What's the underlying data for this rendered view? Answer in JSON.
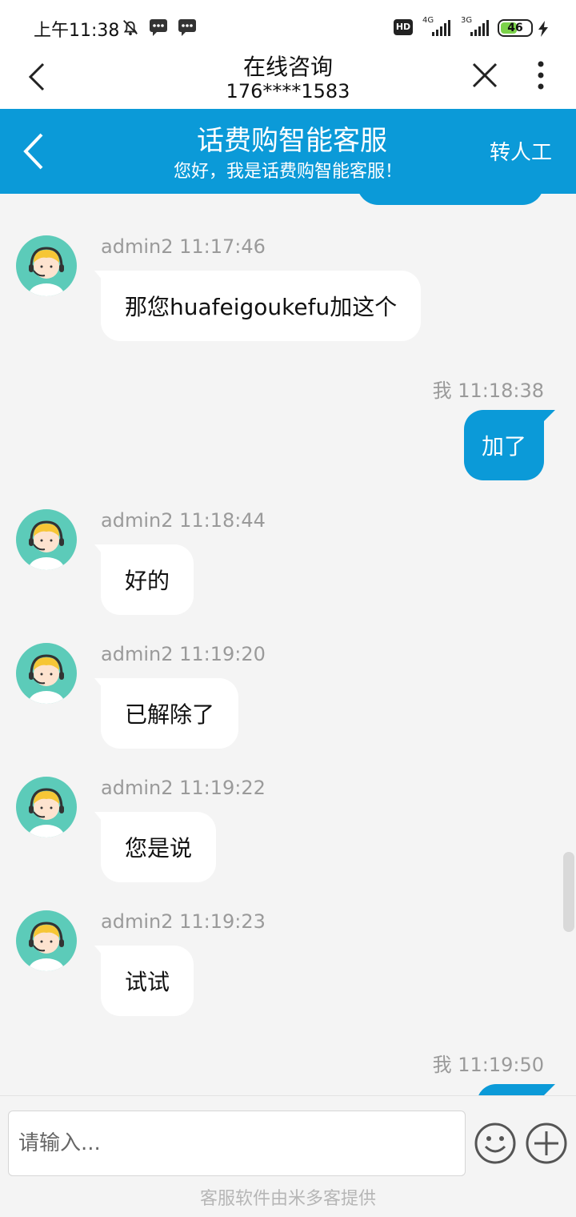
{
  "status_bar": {
    "time": "上午11:38",
    "hd": "HD",
    "net1": "4G",
    "net2": "3G",
    "battery": "46"
  },
  "topbar": {
    "title": "在线咨询",
    "subtitle": "176****1583"
  },
  "header": {
    "title": "话费购智能客服",
    "subtitle": "您好，我是话费购智能客服！",
    "transfer_label": "转人工"
  },
  "messages": [
    {
      "side": "left",
      "sender": "admin2 11:17:46",
      "text": "那您huafeigoukefu加这个"
    },
    {
      "side": "right",
      "sender": "我 11:18:38",
      "text": "加了"
    },
    {
      "side": "left",
      "sender": "admin2 11:18:44",
      "text": "好的"
    },
    {
      "side": "left",
      "sender": "admin2 11:19:20",
      "text": "已解除了"
    },
    {
      "side": "left",
      "sender": "admin2 11:19:22",
      "text": "您是说"
    },
    {
      "side": "left",
      "sender": "admin2 11:19:23",
      "text": "试试"
    },
    {
      "side": "right",
      "sender": "我 11:19:50",
      "text": ""
    }
  ],
  "input": {
    "placeholder": "请输入..."
  },
  "footer": "客服软件由米多客提供",
  "colors": {
    "accent": "#0b9ad8",
    "avatar_bg": "#5ccbb9",
    "background": "#f4f4f4"
  }
}
